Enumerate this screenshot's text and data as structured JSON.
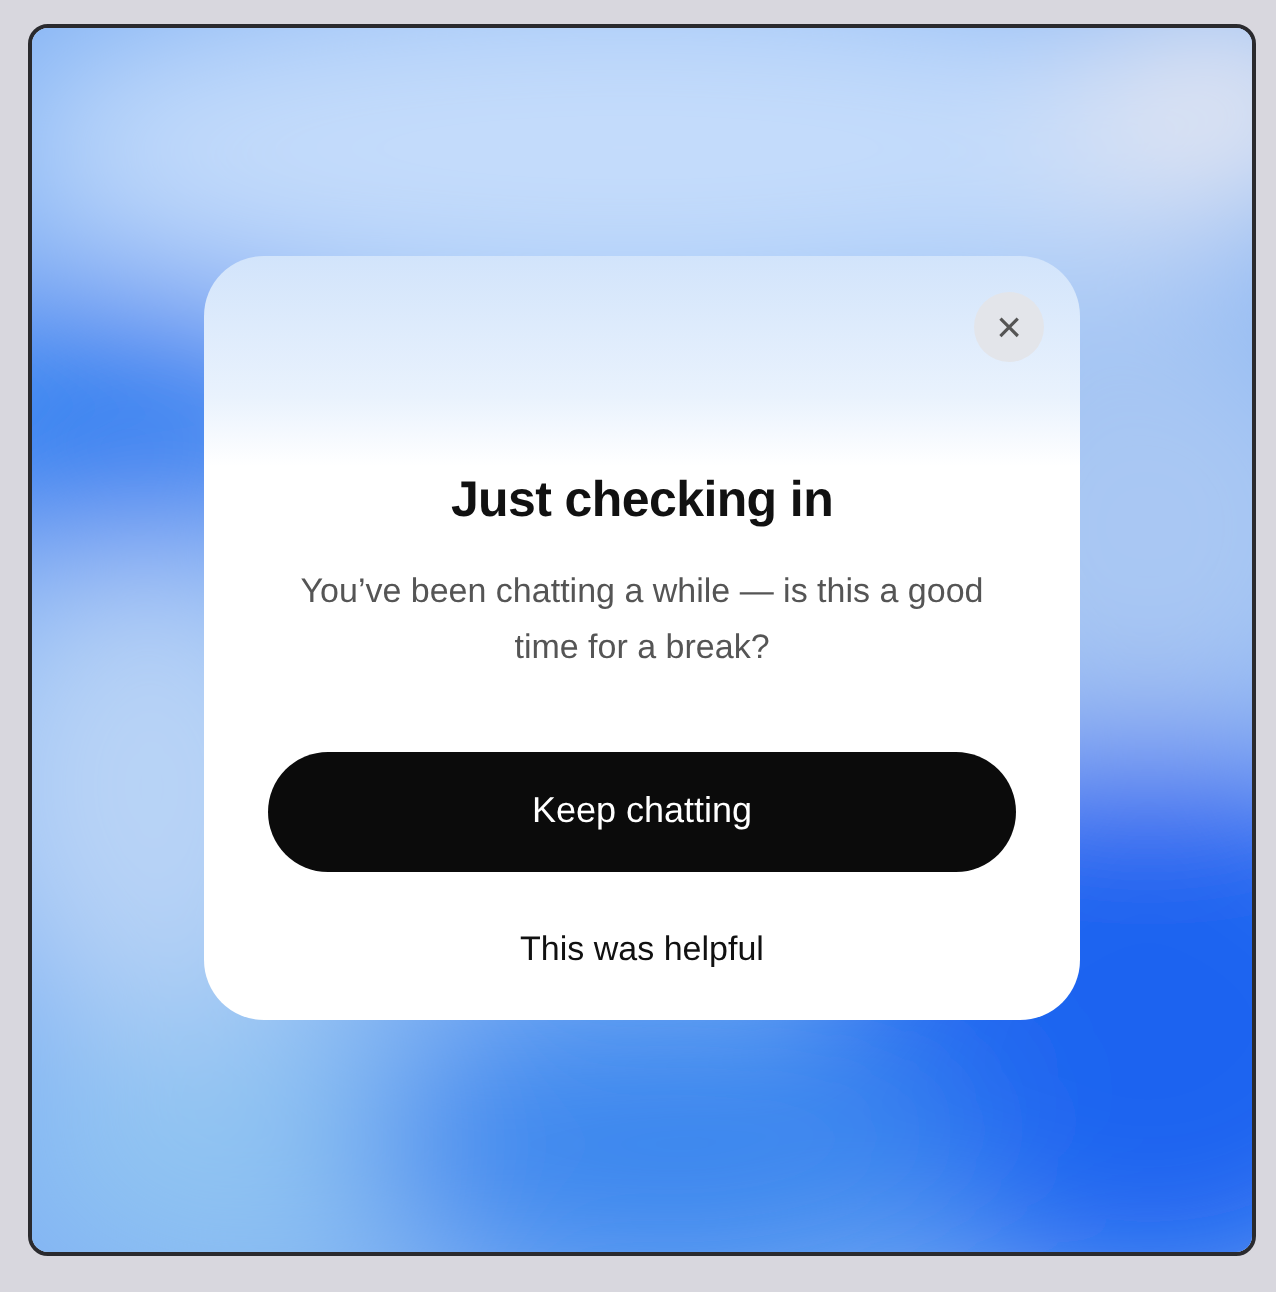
{
  "dialog": {
    "close": "×",
    "title": "Just checking in",
    "message": "You’ve been chatting a while — is this a good time for a break?",
    "primary_button": "Keep chatting",
    "secondary_button": "This was helpful"
  }
}
